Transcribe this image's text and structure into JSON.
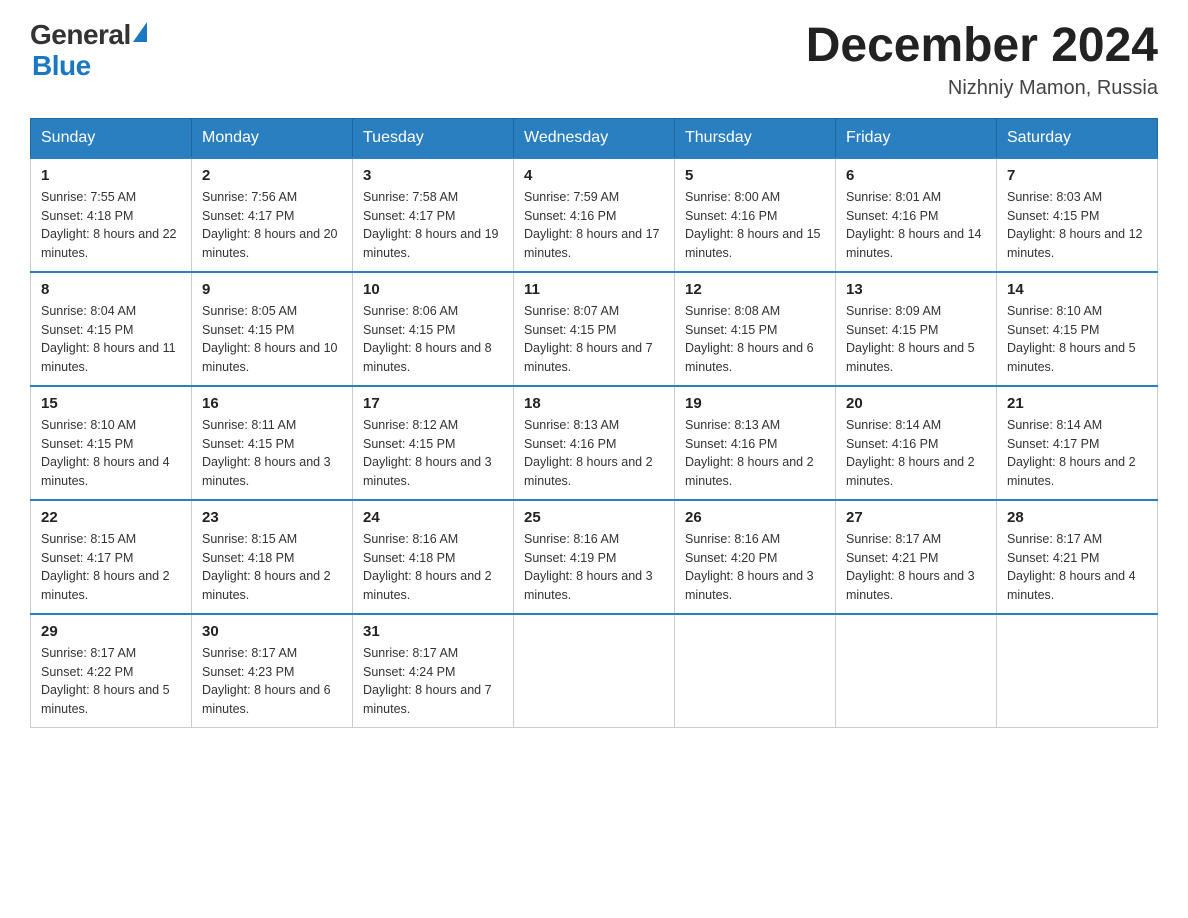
{
  "header": {
    "logo_general": "General",
    "logo_blue": "Blue",
    "month_title": "December 2024",
    "location": "Nizhniy Mamon, Russia"
  },
  "weekdays": [
    "Sunday",
    "Monday",
    "Tuesday",
    "Wednesday",
    "Thursday",
    "Friday",
    "Saturday"
  ],
  "weeks": [
    [
      {
        "day": "1",
        "sunrise": "7:55 AM",
        "sunset": "4:18 PM",
        "daylight": "8 hours and 22 minutes."
      },
      {
        "day": "2",
        "sunrise": "7:56 AM",
        "sunset": "4:17 PM",
        "daylight": "8 hours and 20 minutes."
      },
      {
        "day": "3",
        "sunrise": "7:58 AM",
        "sunset": "4:17 PM",
        "daylight": "8 hours and 19 minutes."
      },
      {
        "day": "4",
        "sunrise": "7:59 AM",
        "sunset": "4:16 PM",
        "daylight": "8 hours and 17 minutes."
      },
      {
        "day": "5",
        "sunrise": "8:00 AM",
        "sunset": "4:16 PM",
        "daylight": "8 hours and 15 minutes."
      },
      {
        "day": "6",
        "sunrise": "8:01 AM",
        "sunset": "4:16 PM",
        "daylight": "8 hours and 14 minutes."
      },
      {
        "day": "7",
        "sunrise": "8:03 AM",
        "sunset": "4:15 PM",
        "daylight": "8 hours and 12 minutes."
      }
    ],
    [
      {
        "day": "8",
        "sunrise": "8:04 AM",
        "sunset": "4:15 PM",
        "daylight": "8 hours and 11 minutes."
      },
      {
        "day": "9",
        "sunrise": "8:05 AM",
        "sunset": "4:15 PM",
        "daylight": "8 hours and 10 minutes."
      },
      {
        "day": "10",
        "sunrise": "8:06 AM",
        "sunset": "4:15 PM",
        "daylight": "8 hours and 8 minutes."
      },
      {
        "day": "11",
        "sunrise": "8:07 AM",
        "sunset": "4:15 PM",
        "daylight": "8 hours and 7 minutes."
      },
      {
        "day": "12",
        "sunrise": "8:08 AM",
        "sunset": "4:15 PM",
        "daylight": "8 hours and 6 minutes."
      },
      {
        "day": "13",
        "sunrise": "8:09 AM",
        "sunset": "4:15 PM",
        "daylight": "8 hours and 5 minutes."
      },
      {
        "day": "14",
        "sunrise": "8:10 AM",
        "sunset": "4:15 PM",
        "daylight": "8 hours and 5 minutes."
      }
    ],
    [
      {
        "day": "15",
        "sunrise": "8:10 AM",
        "sunset": "4:15 PM",
        "daylight": "8 hours and 4 minutes."
      },
      {
        "day": "16",
        "sunrise": "8:11 AM",
        "sunset": "4:15 PM",
        "daylight": "8 hours and 3 minutes."
      },
      {
        "day": "17",
        "sunrise": "8:12 AM",
        "sunset": "4:15 PM",
        "daylight": "8 hours and 3 minutes."
      },
      {
        "day": "18",
        "sunrise": "8:13 AM",
        "sunset": "4:16 PM",
        "daylight": "8 hours and 2 minutes."
      },
      {
        "day": "19",
        "sunrise": "8:13 AM",
        "sunset": "4:16 PM",
        "daylight": "8 hours and 2 minutes."
      },
      {
        "day": "20",
        "sunrise": "8:14 AM",
        "sunset": "4:16 PM",
        "daylight": "8 hours and 2 minutes."
      },
      {
        "day": "21",
        "sunrise": "8:14 AM",
        "sunset": "4:17 PM",
        "daylight": "8 hours and 2 minutes."
      }
    ],
    [
      {
        "day": "22",
        "sunrise": "8:15 AM",
        "sunset": "4:17 PM",
        "daylight": "8 hours and 2 minutes."
      },
      {
        "day": "23",
        "sunrise": "8:15 AM",
        "sunset": "4:18 PM",
        "daylight": "8 hours and 2 minutes."
      },
      {
        "day": "24",
        "sunrise": "8:16 AM",
        "sunset": "4:18 PM",
        "daylight": "8 hours and 2 minutes."
      },
      {
        "day": "25",
        "sunrise": "8:16 AM",
        "sunset": "4:19 PM",
        "daylight": "8 hours and 3 minutes."
      },
      {
        "day": "26",
        "sunrise": "8:16 AM",
        "sunset": "4:20 PM",
        "daylight": "8 hours and 3 minutes."
      },
      {
        "day": "27",
        "sunrise": "8:17 AM",
        "sunset": "4:21 PM",
        "daylight": "8 hours and 3 minutes."
      },
      {
        "day": "28",
        "sunrise": "8:17 AM",
        "sunset": "4:21 PM",
        "daylight": "8 hours and 4 minutes."
      }
    ],
    [
      {
        "day": "29",
        "sunrise": "8:17 AM",
        "sunset": "4:22 PM",
        "daylight": "8 hours and 5 minutes."
      },
      {
        "day": "30",
        "sunrise": "8:17 AM",
        "sunset": "4:23 PM",
        "daylight": "8 hours and 6 minutes."
      },
      {
        "day": "31",
        "sunrise": "8:17 AM",
        "sunset": "4:24 PM",
        "daylight": "8 hours and 7 minutes."
      },
      null,
      null,
      null,
      null
    ]
  ]
}
